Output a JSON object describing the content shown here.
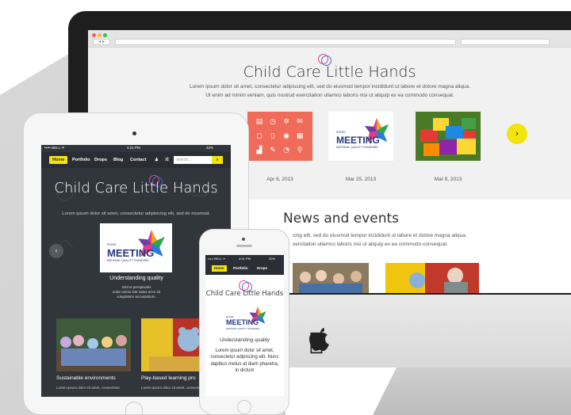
{
  "brand": {
    "name": "Child Care Little Hands",
    "colors": {
      "accent_yellow": "#f4e40e",
      "coral": "#f06b5a",
      "dark_panel": "#31353c",
      "logo_navy": "#25397a",
      "ring_pink": "#e5488f",
      "ring_blue": "#4a6cd4"
    }
  },
  "desktop": {
    "browser": {
      "nav_arrows": "◂ ▸"
    },
    "title": "Child Care Little Hands",
    "intro_line1": "Lorem ipsum dolor sit amet, consectetur adipiscing elit, sed do eiusmod tempor incididunt ut labore et dolore magna aliqua.",
    "intro_line2": "Ut enim ad minim veniam, quis nostrud exercitation ullamco laboris nisi ut aliquip ex ea commodo consequat.",
    "cards": [
      {
        "date": "Apr 6, 2013",
        "kind": "icon-grid"
      },
      {
        "date": "Mar 25, 2013",
        "kind": "meeting-logo"
      },
      {
        "date": "Mar 8, 2013",
        "kind": "lego-photo"
      }
    ],
    "next_icon": "›",
    "news": {
      "title": "News and events",
      "line1": "cing elit, sed do eiusmod tempor incididunt ut labore et dolore magna aliqua.",
      "line2": "xercitation ullamco laboris nisi ut aliquip ex ea commodo consequat."
    }
  },
  "meeting_logo": {
    "small_top": "RATED",
    "word": "MEETING",
    "tagline": "NATIONAL QUALITY STANDARD"
  },
  "tablet": {
    "status": {
      "carrier": "••••• BELL ᯤ",
      "time": "4:21 PM",
      "battery": "22%"
    },
    "nav": [
      "Home",
      "Portfolio",
      "Drops",
      "Blog",
      "Contact"
    ],
    "search_placeholder": "search...",
    "search_icon": "⌕",
    "title": "Child Care Little Hands",
    "intro": "Lorem ipsum dolor sit amet, consectetur adipisicing elit, sed do eiusmod.",
    "prev_icon": "‹",
    "slide_caption": "Understanding quality",
    "slide_text_1": "Sed ut perspiciatis",
    "slide_text_2": "unde omnis iste natus error sit",
    "slide_text_3": "voluptatem accusantium.",
    "cards": [
      {
        "title": "Sustainable environments",
        "text": "Lorem ipsum dolor sit amet, consectetur"
      },
      {
        "title": "Play-based learning pro",
        "text": "Lorem ipsum dolor sit amet, consectetur"
      }
    ]
  },
  "phone": {
    "status": {
      "carrier": "••••• BELL ᯤ",
      "time": "4:21 PM",
      "battery": "22%"
    },
    "nav": [
      "Home",
      "Portfolio",
      "Drops"
    ],
    "title": "Child Care Little Hands",
    "caption": "Understanding quality",
    "text": "Lorem ipsum dolor sit amet, consectetur adipiscing elit. Nunc dapibus metus at diam pharetra, in dictum"
  }
}
